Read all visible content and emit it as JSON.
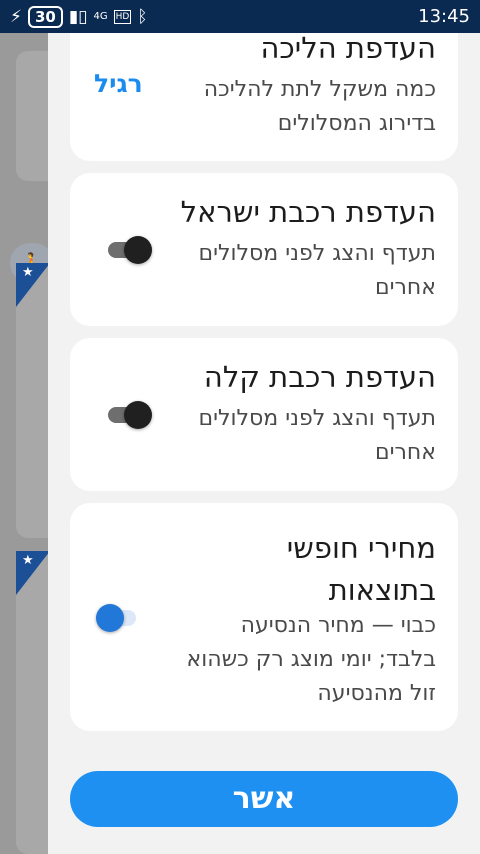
{
  "status_bar": {
    "battery": "30",
    "network": "4G",
    "hd": "HD",
    "time": "13:45"
  },
  "walk_card": {
    "title": "העדפת הליכה",
    "desc_line1": "כמה משקל לתת להליכה",
    "desc_line2": "בדירוג המסלולים",
    "value": "רגיל"
  },
  "israel_rail_card": {
    "title": "העדפת רכבת ישראל",
    "desc_line1": "תעדף והצג לפני מסלולים",
    "desc_line2": "אחרים",
    "toggle_on": true
  },
  "light_rail_card": {
    "title": "העדפת רכבת קלה",
    "desc_line1": "תעדף והצג לפני מסלולים",
    "desc_line2": "אחרים",
    "toggle_on": true
  },
  "free_pass_card": {
    "title_line1": "מחירי חופשי",
    "title_line2": "בתוצאות",
    "desc_line1": "כבוי — מחיר הנסיעה",
    "desc_line2": "בלבד; יומי מוצג רק כשהוא",
    "desc_line3": "זול מהנסיעה",
    "toggle_on": false
  },
  "confirm_label": "אשר",
  "colors": {
    "accent": "#1e90f2",
    "status_bar": "#0b2a52",
    "toggle_off_thumb": "#2278d8",
    "toggle_on_thumb": "#202020"
  }
}
